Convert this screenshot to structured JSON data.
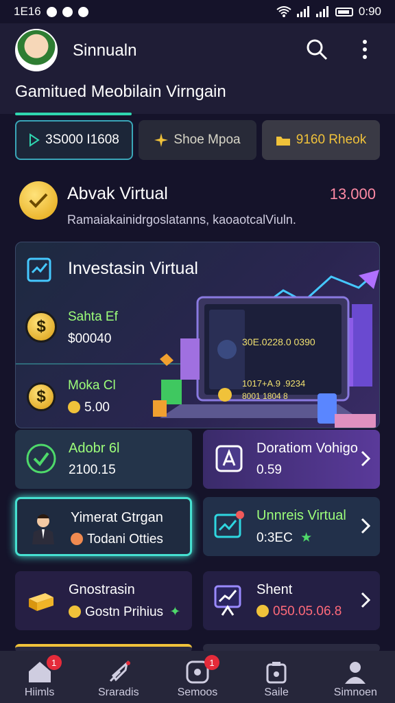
{
  "statusbar": {
    "time": "1E16",
    "clock": "0:90"
  },
  "appbar": {
    "app_name": "Sinnualn",
    "subtitle": "Gamitued Meobilain Virngain"
  },
  "chips": [
    {
      "label": "3S000 I1608"
    },
    {
      "label": "Shoe Mpoa"
    },
    {
      "label": "9160 Rheok"
    }
  ],
  "hero": {
    "title": "Abvak Virtual",
    "value": "13.000",
    "description": "Ramaiakainidrgoslatanns, kaoaotcalViuln."
  },
  "investment": {
    "title": "Investasin Virtual",
    "rows": [
      {
        "label": "Sahta Ef",
        "value": "$00040"
      },
      {
        "label": "Moka Cl",
        "value": "5.00"
      }
    ],
    "screen_lines": [
      "30E.0228.0 0390",
      "1017+A.9 .9234",
      "8001 1804 8"
    ]
  },
  "cards": [
    {
      "title": "Adobr 6l",
      "subtitle": "2100.15"
    },
    {
      "title": "Doratiom Vohigo",
      "subtitle": "0.59"
    },
    {
      "title": "Yimerat Gtrgan",
      "subtitle": "Todani Otties"
    },
    {
      "title": "Unnreis Virtual",
      "subtitle": "0:3EC"
    },
    {
      "title": "Gnostrasin",
      "subtitle": "Gostn Prihius"
    },
    {
      "title": "Shent",
      "subtitle": "050.05.06.8"
    }
  ],
  "nav": [
    {
      "label": "Hiimls",
      "badge": "1"
    },
    {
      "label": "Sraradis",
      "badge": ""
    },
    {
      "label": "Semoos",
      "badge": "1"
    },
    {
      "label": "Saile",
      "badge": ""
    },
    {
      "label": "Simnoen",
      "badge": ""
    }
  ],
  "colors": {
    "background": "#15132a",
    "accent_teal": "#2fd6b0",
    "gold": "#f0c23a",
    "value_pink": "#ff8aa5",
    "label_green": "#9dff7a"
  }
}
